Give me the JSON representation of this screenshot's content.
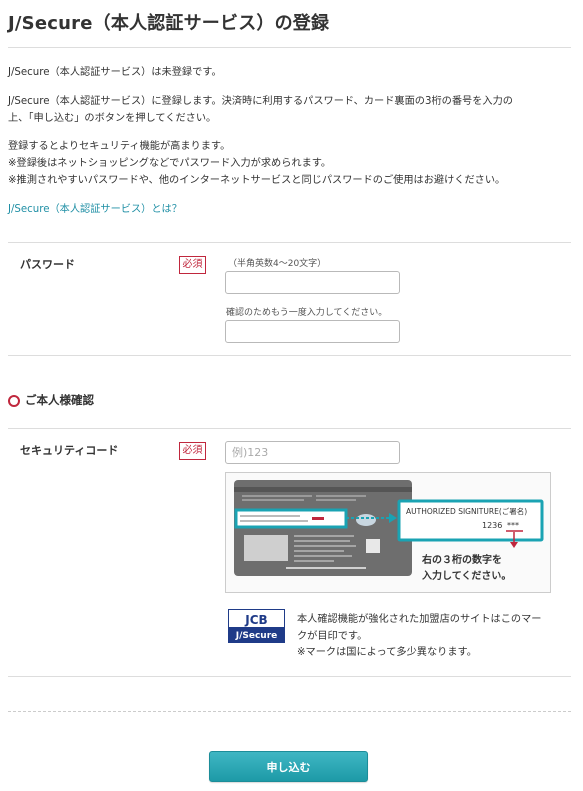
{
  "page": {
    "title": "J/Secure（本人認証サービス）の登録"
  },
  "intro": {
    "status": "J/Secure（本人認証サービス）は未登録です。",
    "instruction_line1": "J/Secure（本人認証サービス）に登録します。決済時に利用するパスワード、カード裏面の3桁の番号を入力の",
    "instruction_line2": "上、「申し込む」のボタンを押してください。",
    "notes": [
      "登録するとよりセキュリティ機能が高まります。",
      "※登録後はネットショッピングなどでパスワード入力が求められます。",
      "※推測されやすいパスワードや、他のインターネットサービスと同じパスワードのご使用はお避けください。"
    ],
    "about_link": "J/Secure（本人認証サービス）とは？"
  },
  "password": {
    "label": "パスワード",
    "required": "必須",
    "hint": "（半角英数4～20文字）",
    "value": "",
    "confirm_hint": "確認のためもう一度入力してください。",
    "confirm_value": ""
  },
  "identity_section": {
    "title": "ご本人様確認"
  },
  "security_code": {
    "label": "セキュリティコード",
    "required": "必須",
    "placeholder": "例)123",
    "value": ""
  },
  "card_illustration": {
    "signature_label": "AUTHORIZED SIGNITURE(ご署名)",
    "signature_number": "1236",
    "signature_mask": "***",
    "caption_line1": "右の３桁の数字を",
    "caption_line2": "入力してください。",
    "colors": {
      "card": "#707070",
      "highlight": "#1aa3b3",
      "mark": "#c0273d"
    }
  },
  "jcb": {
    "logo_top": "JCB",
    "logo_bottom": "J/Secure",
    "note_line1": "本人確認機能が強化された加盟店のサイトはこのマー",
    "note_line2": "クが目印です。",
    "note_line3": "※マークは国によって多少異なります。"
  },
  "actions": {
    "submit_label": "申し込む"
  },
  "theme": {
    "accent": "#1f8fa5",
    "required_red": "#c0273d",
    "button": "#26a5b2"
  }
}
